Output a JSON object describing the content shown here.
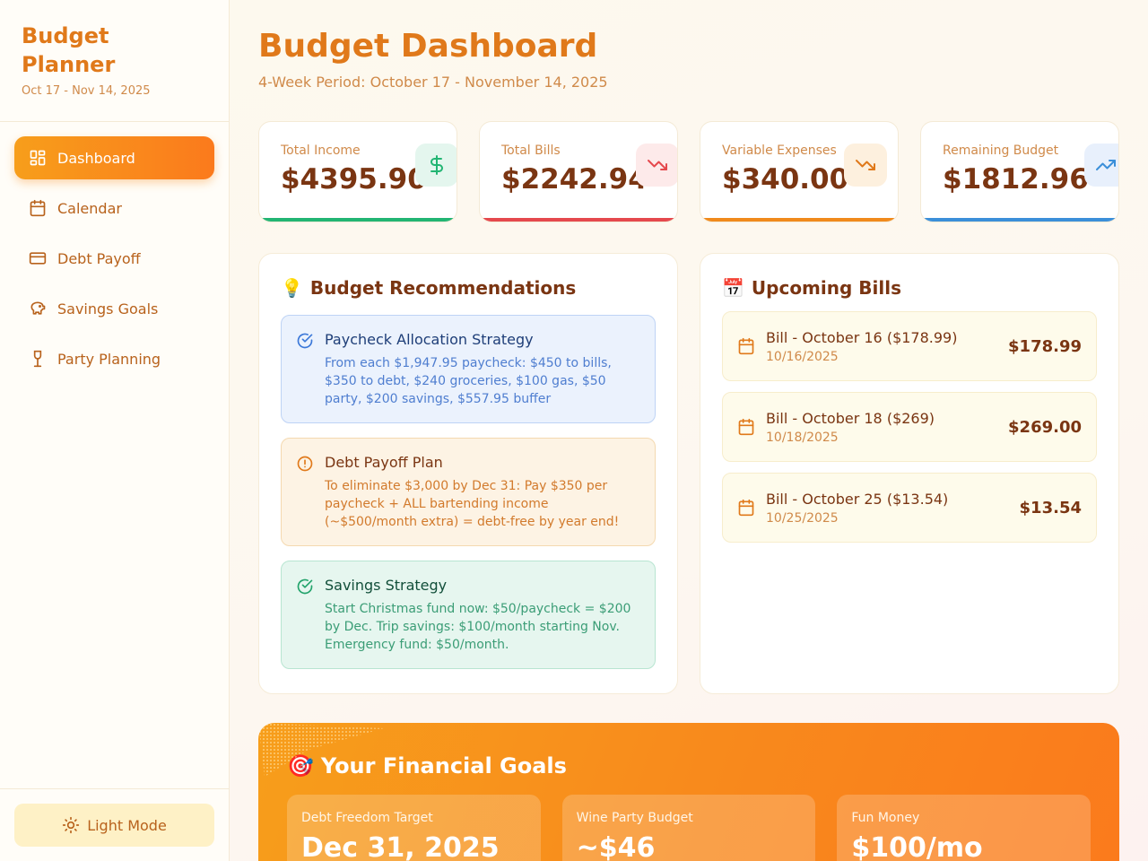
{
  "sidebar": {
    "brand_title": "Budget Planner",
    "brand_subtitle": "Oct 17 - Nov 14, 2025",
    "items": [
      {
        "label": "Dashboard",
        "icon": "dashboard-icon",
        "active": true
      },
      {
        "label": "Calendar",
        "icon": "calendar-icon"
      },
      {
        "label": "Debt Payoff",
        "icon": "credit-card-icon"
      },
      {
        "label": "Savings Goals",
        "icon": "piggy-bank-icon"
      },
      {
        "label": "Party Planning",
        "icon": "wine-glass-icon"
      }
    ],
    "mode_label": "Light Mode"
  },
  "header": {
    "title": "Budget Dashboard",
    "subtitle": "4-Week Period: October 17 - November 14, 2025"
  },
  "stats": [
    {
      "label": "Total Income",
      "value": "$4395.90",
      "icon": "dollar-icon",
      "color": "#22b573"
    },
    {
      "label": "Total Bills",
      "value": "$2242.94",
      "icon": "trending-down-icon",
      "color": "#e5484d"
    },
    {
      "label": "Variable Expenses",
      "value": "$340.00",
      "icon": "trending-down-icon",
      "color": "#f08a1c"
    },
    {
      "label": "Remaining Budget",
      "value": "$1812.96",
      "icon": "trending-up-icon",
      "color": "#3b8fd9"
    }
  ],
  "recommendations": {
    "title": "Budget Recommendations",
    "items": [
      {
        "title": "Paycheck Allocation Strategy",
        "text": "From each $1,947.95 paycheck: $450 to bills, $350 to debt, $240 groceries, $100 gas, $50 party, $200 savings, $557.95 buffer"
      },
      {
        "title": "Debt Payoff Plan",
        "text": "To eliminate $3,000 by Dec 31: Pay $350 per paycheck + ALL bartending income (~$500/month extra) = debt-free by year end!"
      },
      {
        "title": "Savings Strategy",
        "text": "Start Christmas fund now: $50/paycheck = $200 by Dec. Trip savings: $100/month starting Nov. Emergency fund: $50/month."
      }
    ]
  },
  "bills": {
    "title": "Upcoming Bills",
    "items": [
      {
        "name": "Bill - October 16 ($178.99)",
        "date": "10/16/2025",
        "amount": "$178.99"
      },
      {
        "name": "Bill - October 18 ($269)",
        "date": "10/18/2025",
        "amount": "$269.00"
      },
      {
        "name": "Bill - October 25 ($13.54)",
        "date": "10/25/2025",
        "amount": "$13.54"
      }
    ]
  },
  "goals": {
    "title": "Your Financial Goals",
    "items": [
      {
        "label": "Debt Freedom Target",
        "value": "Dec 31, 2025"
      },
      {
        "label": "Wine Party Budget",
        "value": "~$46"
      },
      {
        "label": "Fun Money",
        "value": "$100/mo"
      }
    ]
  }
}
